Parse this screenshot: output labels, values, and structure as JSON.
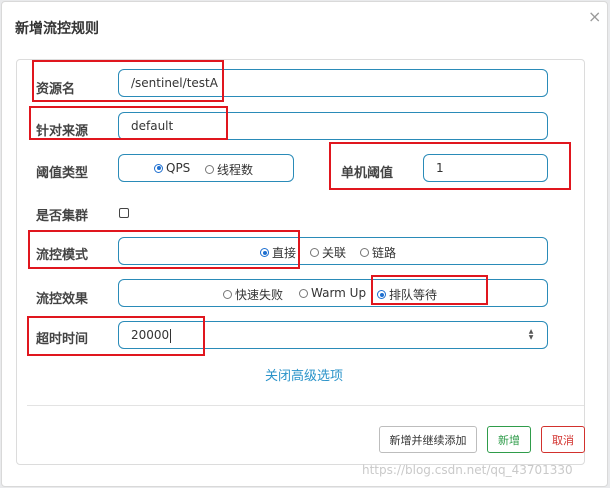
{
  "dialog": {
    "title": "新增流控规则",
    "close_glyph": "×"
  },
  "form": {
    "resource": {
      "label": "资源名",
      "value": "/sentinel/testA"
    },
    "limit_app": {
      "label": "针对来源",
      "value": "default"
    },
    "threshold_type": {
      "label": "阈值类型",
      "options": [
        {
          "label": "QPS",
          "selected": true
        },
        {
          "label": "线程数",
          "selected": false
        }
      ]
    },
    "single_threshold": {
      "label": "单机阈值",
      "value": "1"
    },
    "cluster": {
      "label": "是否集群",
      "checked": false
    },
    "strategy": {
      "label": "流控模式",
      "options": [
        {
          "label": "直接",
          "selected": true
        },
        {
          "label": "关联",
          "selected": false
        },
        {
          "label": "链路",
          "selected": false
        }
      ]
    },
    "control_behavior": {
      "label": "流控效果",
      "options": [
        {
          "label": "快速失败",
          "selected": false
        },
        {
          "label": "Warm Up",
          "selected": false
        },
        {
          "label": "排队等待",
          "selected": true
        }
      ]
    },
    "timeout": {
      "label": "超时时间",
      "value": "20000"
    },
    "advanced_link": "关闭高级选项"
  },
  "footer": {
    "save_continue_label": "新增并继续添加",
    "add_label": "新增",
    "cancel_label": "取消"
  },
  "watermark": "https://blog.csdn.net/qq_43701330",
  "colors": {
    "accent_border": "#2a8bb8",
    "annotation_red": "#e0161e",
    "link_blue": "#2a93c9",
    "add_green": "#2f9c4a",
    "cancel_red": "#d2312d"
  }
}
